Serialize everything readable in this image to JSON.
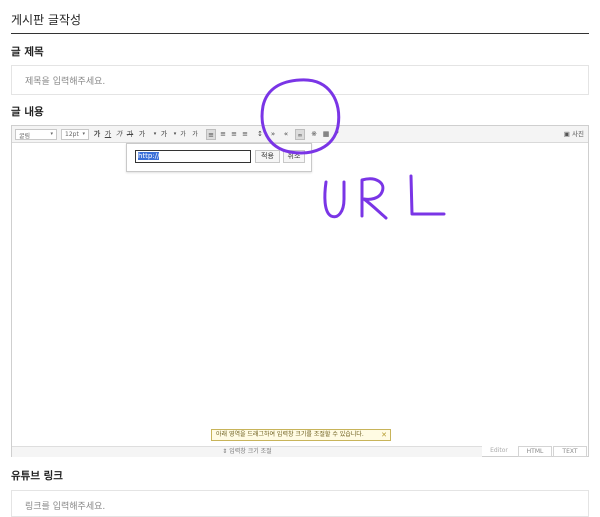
{
  "page": {
    "title": "게시판 글작성"
  },
  "title_field": {
    "label": "글 제목",
    "placeholder": "제목을 입력해주세요."
  },
  "content_field": {
    "label": "글 내용"
  },
  "toolbar": {
    "font_name": "굴림",
    "font_size": "12pt",
    "buttons": [
      "가",
      "가",
      "가",
      "가",
      "가",
      "가",
      "가",
      "가",
      "가"
    ],
    "photo_label": "사진"
  },
  "url_popup": {
    "value": "http://",
    "apply_label": "적용",
    "cancel_label": "취소"
  },
  "editor_footer": {
    "resize_tip": "아래 영역을 드래그하여 입력창 크기를 조절할 수 있습니다.",
    "resize_label": "입력창 크기 조절",
    "tabs": [
      "Editor",
      "HTML",
      "TEXT"
    ]
  },
  "youtube_field": {
    "label": "유튜브 링크",
    "placeholder": "링크를 입력해주세요."
  },
  "annotation": {
    "text": "URL",
    "color": "#7a35e6"
  }
}
